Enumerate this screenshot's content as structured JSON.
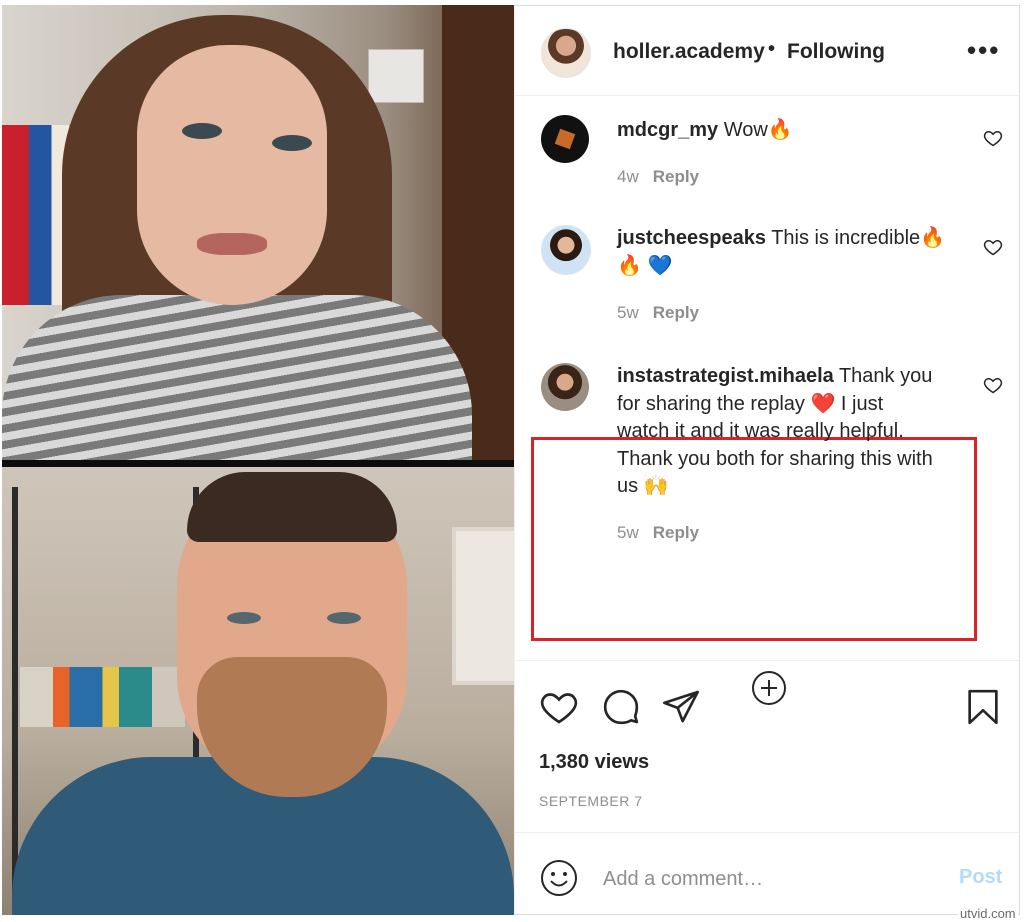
{
  "post": {
    "username": "holler.academy",
    "separator": "•",
    "follow_status": "Following",
    "more_icon": "ellipsis-icon",
    "more_label": "•••"
  },
  "comments": [
    {
      "username": "mdcgr_my",
      "text": "Wow🔥",
      "time": "4w",
      "reply_label": "Reply"
    },
    {
      "username": "justcheespeaks",
      "text": "This is incredible🔥",
      "text2": "🔥 💙",
      "time": "5w",
      "reply_label": "Reply"
    },
    {
      "username": "instastrategist.mihaela",
      "text": "Thank you",
      "text2": "for sharing the replay ❤️ I just",
      "text3": "watch it and it was really helpful.",
      "text4": "Thank you both for sharing this with",
      "text5": "us 🙌",
      "time": "5w",
      "reply_label": "Reply",
      "highlighted": true
    }
  ],
  "actions": {
    "like_icon": "heart-icon",
    "comment_icon": "comment-icon",
    "share_icon": "paper-plane-icon",
    "save_icon": "bookmark-icon",
    "load_more_icon": "plus-circle-icon"
  },
  "stats": {
    "views": "1,380 views",
    "date": "SEPTEMBER 7"
  },
  "add_comment": {
    "placeholder": "Add a comment…",
    "post_label": "Post",
    "emoji_icon": "smiley-icon"
  },
  "watermark": "utvid.com",
  "colors": {
    "highlight": "#d9222a",
    "post_disabled": "#b3dbff",
    "muted": "#8e8e8e"
  }
}
